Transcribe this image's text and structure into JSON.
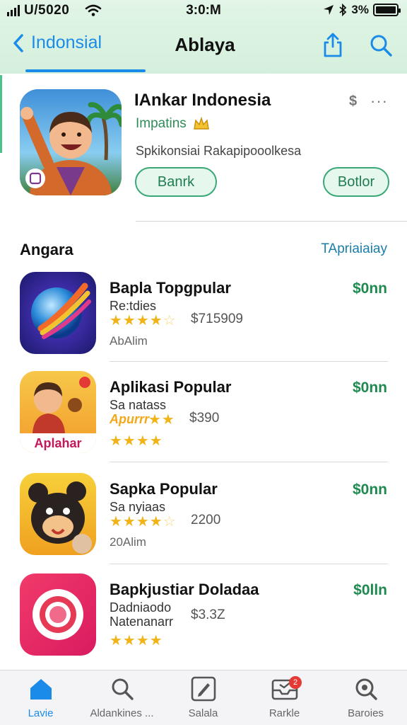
{
  "status_bar": {
    "carrier": "U/5020",
    "time": "3:0:M",
    "battery": "3%"
  },
  "nav": {
    "back_label": "Indonsial",
    "title": "Ablaya",
    "icons": [
      "share-icon",
      "search-icon"
    ],
    "accent_color": "#1a8be8"
  },
  "featured": {
    "title": "IAnkar Indonesia",
    "subtitle": "Impatins",
    "description": "Spkikonsiai Rakapipooolkesa",
    "price_symbol": "$",
    "more": "···",
    "button_primary": "Banrk",
    "button_secondary": "Botlor"
  },
  "section": {
    "title": "Angara",
    "link": "TApriaiaiay"
  },
  "apps": [
    {
      "name": "Bapla Topgpular",
      "sub": "Re:tdies",
      "rating": 4.5,
      "price": "$715909",
      "extra": "AbAlim",
      "action": "$0nn"
    },
    {
      "name": "Aplikasi Popular",
      "sub": "Sa natass",
      "tag": "Apurrr",
      "rating": 4,
      "price": "$390",
      "extra": "",
      "icon_caption": "Aplahar",
      "action": "$0nn"
    },
    {
      "name": "Sapka Popular",
      "sub": "Sa nyiaas",
      "rating": 4.5,
      "price": "2200",
      "extra": "20Alim",
      "action": "$0nn"
    },
    {
      "name": "Bapkjustiar Doladaa",
      "sub": "Dadniaodo",
      "sub2": "Natenanarr",
      "rating": 4,
      "price": "$3.3Z",
      "extra": "",
      "action": "$0lln"
    }
  ],
  "tabs": [
    {
      "label": "Lavie",
      "icon": "home-icon",
      "active": true
    },
    {
      "label": "Aldankines ...",
      "icon": "search-icon",
      "active": false
    },
    {
      "label": "Salala",
      "icon": "edit-icon",
      "active": false
    },
    {
      "label": "Rarkle",
      "icon": "inbox-icon",
      "active": false,
      "badge": "2"
    },
    {
      "label": "Baroies",
      "icon": "discover-icon",
      "active": false
    }
  ]
}
